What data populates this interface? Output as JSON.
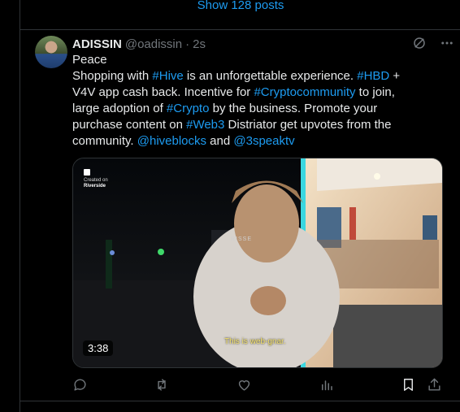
{
  "thread": {
    "show_more_label": "Show 128 posts"
  },
  "post": {
    "author_name": "ADISSIN",
    "author_handle": "@oadissin",
    "separator": "·",
    "time": "2s",
    "lines": [
      [
        {
          "t": "Peace",
          "tag": false
        }
      ],
      [
        {
          "t": "Shopping with ",
          "tag": false
        },
        {
          "t": "#Hive",
          "tag": true
        },
        {
          "t": " is an unforgettable experience. ",
          "tag": false
        },
        {
          "t": "#HBD",
          "tag": true
        },
        {
          "t": " +",
          "tag": false
        }
      ],
      [
        {
          "t": "V4V app cash back. Incentive for  ",
          "tag": false
        },
        {
          "t": "#Cryptocommunity",
          "tag": true
        },
        {
          "t": " to join,",
          "tag": false
        }
      ],
      [
        {
          "t": "large adoption of ",
          "tag": false
        },
        {
          "t": "#Crypto",
          "tag": true
        },
        {
          "t": " by the business.  Promote your",
          "tag": false
        }
      ],
      [
        {
          "t": "purchase content on ",
          "tag": false
        },
        {
          "t": "#Web3",
          "tag": true
        },
        {
          "t": " Distriator get upvotes from  the",
          "tag": false
        }
      ],
      [
        {
          "t": "community. ",
          "tag": false
        },
        {
          "t": "@hiveblocks",
          "tag": true
        },
        {
          "t": " and ",
          "tag": false
        },
        {
          "t": "@3speaktv",
          "tag": true
        }
      ]
    ]
  },
  "media": {
    "brand_top": "Created on",
    "brand_name": "Riverside",
    "caption": "This is web-gnar.",
    "duration": "3:38",
    "sign_text": "RISSE"
  },
  "icons": {
    "grok": "grok-icon",
    "more": "more-icon",
    "reply": "reply-icon",
    "repost": "repost-icon",
    "like": "like-icon",
    "views": "views-icon",
    "bookmark": "bookmark-icon",
    "share": "share-icon"
  },
  "colors": {
    "accent": "#1d9bf0",
    "text": "#e7e9ea",
    "muted": "#71767b",
    "border": "#2f3336",
    "caption": "#f5e36b"
  }
}
